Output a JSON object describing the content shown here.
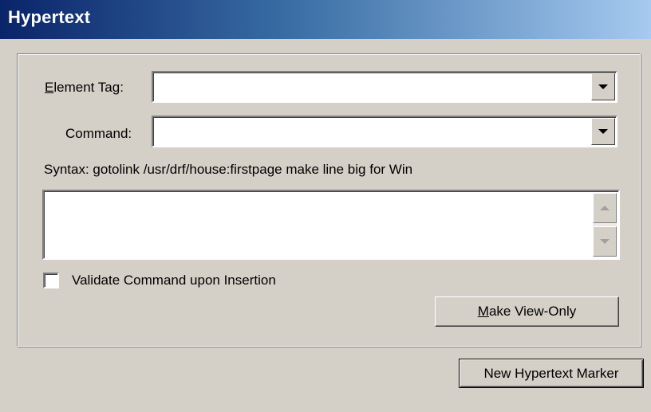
{
  "window": {
    "title": "Hypertext"
  },
  "form": {
    "element_tag": {
      "label_accel": "E",
      "label_rest": "lement Tag:",
      "value": ""
    },
    "command": {
      "label": "Command:",
      "value": ""
    },
    "syntax_text": "Syntax:  gotolink /usr/drf/house:firstpage make line big for Win",
    "command_text": "",
    "validate_checkbox": {
      "label": "Validate Command upon Insertion",
      "checked": false
    },
    "make_view_only": {
      "accel": "M",
      "rest": "ake View-Only"
    }
  },
  "footer": {
    "new_marker_label": "New Hypertext Marker"
  },
  "icons": {
    "dropdown": "chevron-down-icon",
    "scroll_up": "scroll-up-icon",
    "scroll_down": "scroll-down-icon"
  },
  "colors": {
    "titlebar_start": "#0a246a",
    "titlebar_end": "#a6caf0",
    "face": "#d4d0c8"
  }
}
